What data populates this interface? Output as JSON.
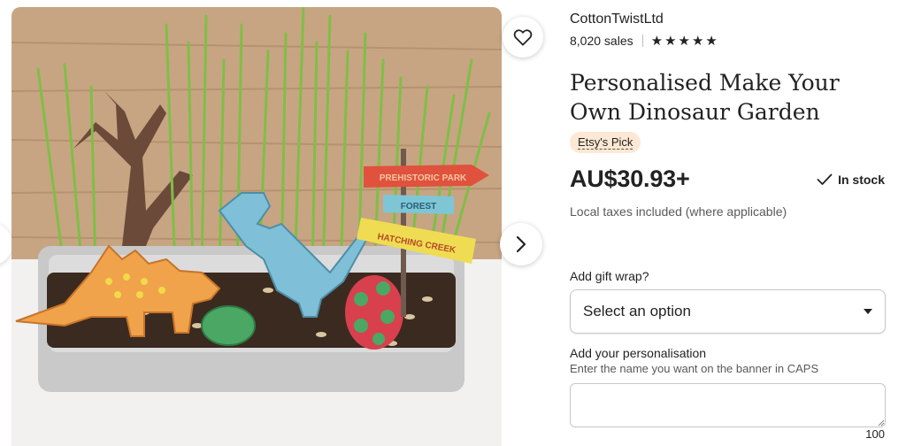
{
  "gallery": {
    "image_alt": "Personalised Make Your Own Dinosaur Garden",
    "sign_text": [
      "PREHISTORIC PARK",
      "FOREST",
      "HATCHING CREEK"
    ]
  },
  "shop": {
    "name": "CottonTwistLtd",
    "sales": "8,020 sales",
    "rating": 5
  },
  "listing": {
    "title": "Personalised Make Your Own Dinosaur Garden",
    "badge": "Etsy's Pick",
    "price": "AU$30.93+",
    "stock": "In stock",
    "tax_note": "Local taxes included (where applicable)"
  },
  "gift_wrap": {
    "label": "Add gift wrap?",
    "selected": "Select an option"
  },
  "personalisation": {
    "label": "Add your personalisation",
    "hint": "Enter the name you want on the banner in CAPS",
    "value": "",
    "remaining": "100"
  },
  "colors": {
    "badge_bg": "#fde8d3",
    "text": "#222222"
  }
}
